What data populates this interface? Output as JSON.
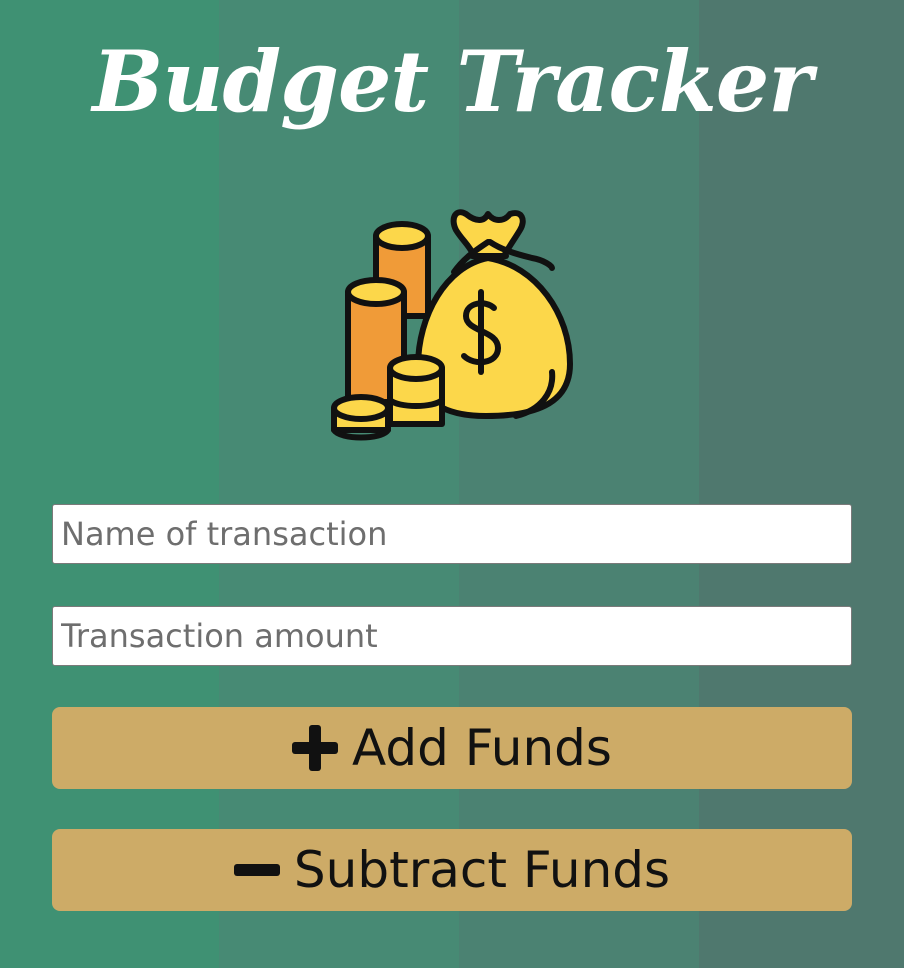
{
  "app": {
    "title": "Budget Tracker"
  },
  "form": {
    "name_field": {
      "value": "",
      "placeholder": "Name of transaction"
    },
    "amount_field": {
      "value": "",
      "placeholder": "Transaction amount"
    },
    "add_label": "Add Funds",
    "subtract_label": "Subtract Funds"
  },
  "icons": {
    "hero": "money-bag-and-coins-icon",
    "add": "plus-icon",
    "subtract": "minus-icon"
  },
  "colors": {
    "button": "#cdab67",
    "title": "#ffffff",
    "coin_yellow": "#fcd74a",
    "coin_orange": "#f09b38"
  }
}
